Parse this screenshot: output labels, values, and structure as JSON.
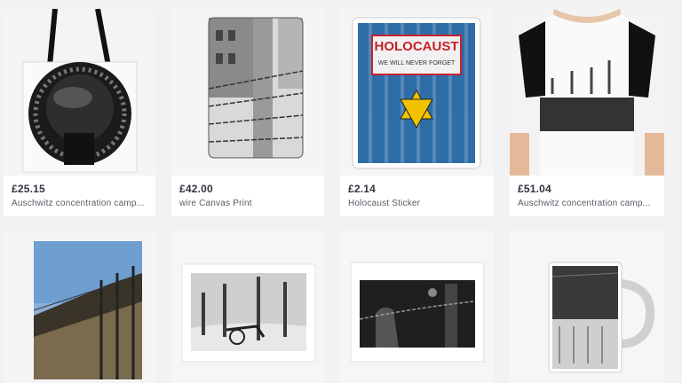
{
  "products": [
    {
      "price": "£25.15",
      "title": "Auschwitz concentration camp...",
      "image": "tote-bag"
    },
    {
      "price": "£42.00",
      "title": "wire Canvas Print",
      "image": "canvas-print-barbed-wire"
    },
    {
      "price": "£2.14",
      "title": "Holocaust Sticker",
      "image": "sticker-star-of-david"
    },
    {
      "price": "£51.04",
      "title": "Auschwitz concentration camp...",
      "image": "graphic-tshirt"
    },
    {
      "image": "canvas-print-camp-fence"
    },
    {
      "image": "art-print-wheelbarrow"
    },
    {
      "image": "art-print-wire-fence"
    },
    {
      "image": "mug"
    }
  ],
  "sticker": {
    "headline": "HOLOCAUST",
    "subline": "WE WILL NEVER FORGET"
  },
  "colors": {
    "background": "#f2f2f5",
    "card": "#ffffff",
    "sticker_blue": "#2f6da6",
    "star_yellow": "#f2c200",
    "sticker_red": "#c8202a"
  }
}
